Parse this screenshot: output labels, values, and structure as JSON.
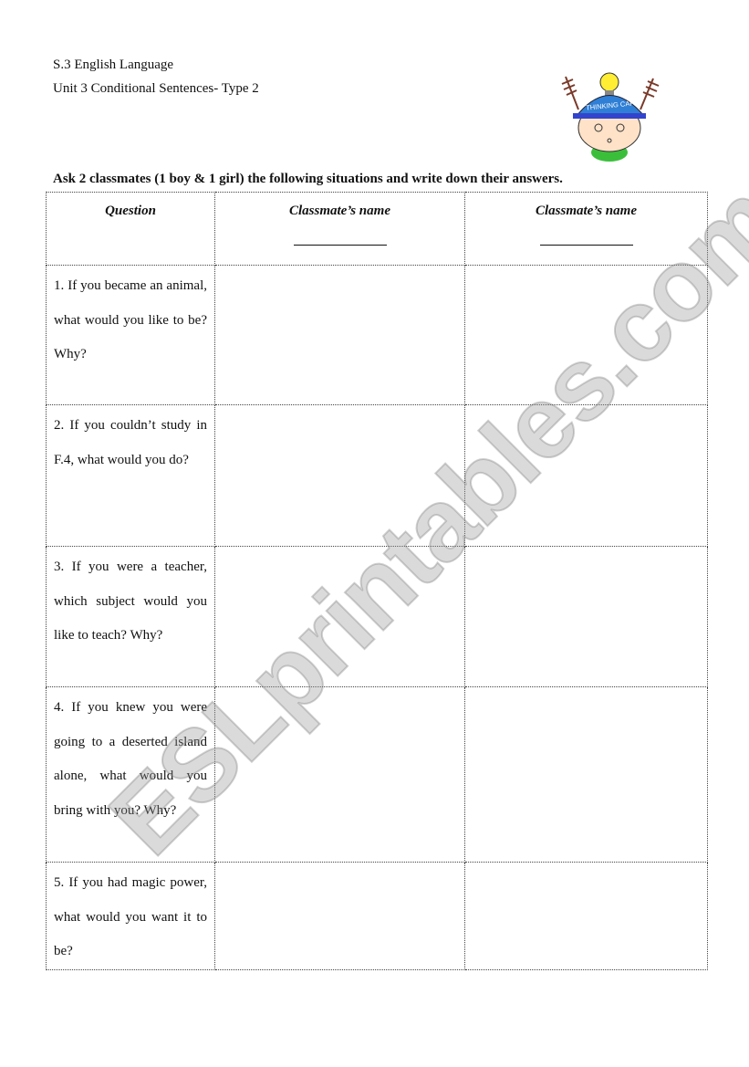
{
  "header": {
    "line1": "S.3 English Language",
    "line2": "Unit 3 Conditional Sentences- Type 2"
  },
  "instruction": "Ask 2 classmates (1 boy & 1 girl) the following situations and write down their answers.",
  "illustration": {
    "name": "thinking-cap-boy",
    "cap_text": "THINKING CAP",
    "cap_color": "#2f7fd6"
  },
  "table": {
    "headers": [
      "Question",
      "Classmate’s name",
      "Classmate’s name"
    ],
    "rows": [
      {
        "height": 153,
        "question": "1. If you became an animal, what would you like to be? Why?"
      },
      {
        "height": 155,
        "question": "2. If you couldn’t study in F.4, what would you do?"
      },
      {
        "height": 154,
        "question": "3. If you were a teacher, which subject would you like to teach? Why?"
      },
      {
        "height": 192,
        "question": "4. If you knew you were going to a deserted island alone, what would you bring with you? Why?"
      },
      {
        "height": 117,
        "question": "5. If you had magic power, what would you want it to be?"
      }
    ]
  },
  "watermark": "ESLprintables.com"
}
